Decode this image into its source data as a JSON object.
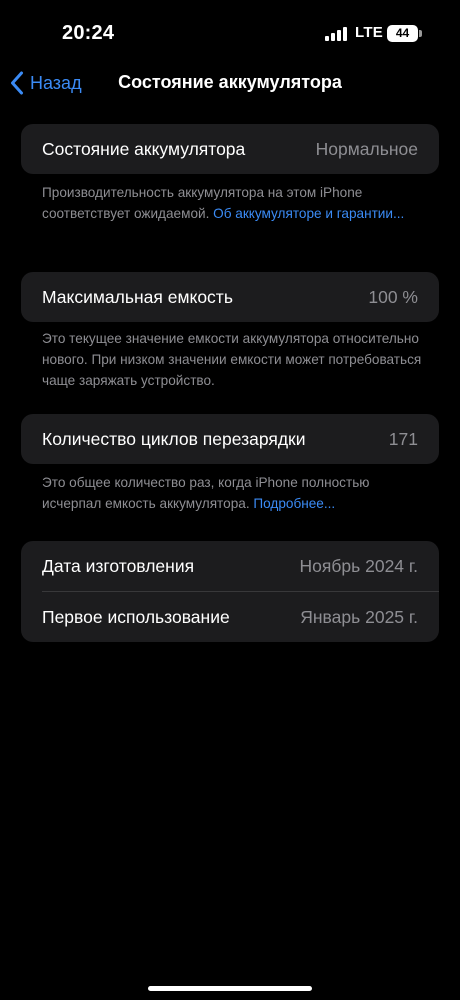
{
  "status_bar": {
    "time": "20:24",
    "network": "LTE",
    "battery_level": "44",
    "signal_bars": 4
  },
  "nav": {
    "back_label": "Назад",
    "title": "Состояние аккумулятора"
  },
  "battery_health": {
    "label": "Состояние аккумулятора",
    "value": "Нормальное",
    "footnote_text": "Производительность аккумулятора на этом iPhone соответствует ожидаемой. ",
    "footnote_link": "Об аккумуляторе и гаран­тии..."
  },
  "max_capacity": {
    "label": "Максимальная емкость",
    "value": "100 %",
    "footnote_text": "Это текущее значение емкости аккумулятора относительно нового. При низком значении емкости может потребоваться чаще заряжать устройство."
  },
  "cycle_count": {
    "label": "Количество циклов перезарядки",
    "value": "171",
    "footnote_text": "Это общее количество раз, когда iPhone полностью исчерпал емкость аккумулятора. ",
    "footnote_link": "Подробнее..."
  },
  "dates": {
    "manufacture_label": "Дата изготовления",
    "manufacture_value": "Ноябрь 2024 г.",
    "first_use_label": "Первое использование",
    "first_use_value": "Январь 2025 г."
  },
  "colors": {
    "accent": "#3b8bf5",
    "cell_background": "#1c1c1e",
    "secondary_text": "#8e8e93"
  }
}
